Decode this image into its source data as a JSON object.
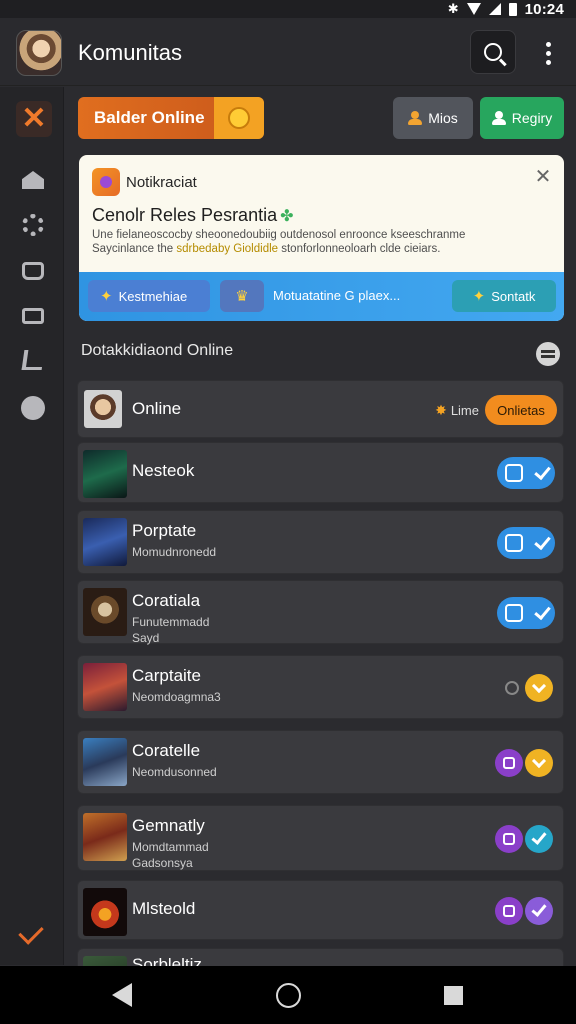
{
  "status_bar": {
    "time": "10:24"
  },
  "header": {
    "title": "Komunitas"
  },
  "actions": {
    "leader_label": "Balder Online",
    "mios_label": "Mios",
    "regis_label": "Regiry"
  },
  "notification": {
    "title": "Notikraciat",
    "subtitle": "Cenolr Reles Pesrantia",
    "body_line1": "Une fielaneoscocby sheoonedoubiig outdenosol enroonce kseeschranme",
    "body_line2_a": "Saycinlance the ",
    "body_line2_highlight": "sdrbedaby Gioldidle",
    "body_line2_b": " stonforlonneoloarh clde cieiars.",
    "pill1_label": "Kestmehiae",
    "footer_text": "Motuatatine G plaex...",
    "pill3_label": "Sontatk"
  },
  "section": {
    "title": "Dotakkidiaond Online"
  },
  "rows": [
    {
      "title": "Online",
      "time_label": "Lime",
      "badge": "Onlietas"
    },
    {
      "title": "Nesteok"
    },
    {
      "title": "Porptate",
      "sub1": "Momudnronedd"
    },
    {
      "title": "Coratiala",
      "sub1": "Funutemmadd",
      "sub2": "Sayd"
    },
    {
      "title": "Carptaite",
      "sub1": "Neomdoagmna3"
    },
    {
      "title": "Coratelle",
      "sub1": "Neomdusonned"
    },
    {
      "title": "Gemnatly",
      "sub1": "Momdtammad",
      "sub2": "Gadsonsya"
    },
    {
      "title": "Mlsteold"
    },
    {
      "title": "Sorbleltiz"
    }
  ]
}
